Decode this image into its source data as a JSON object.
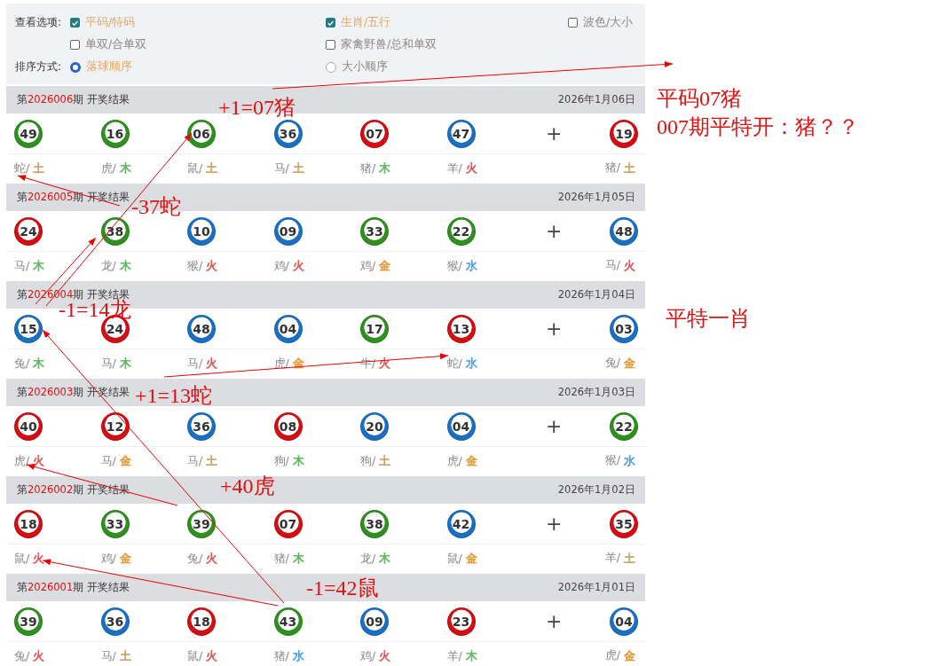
{
  "options": {
    "view_label": "查看选项:",
    "view": [
      {
        "label": "平码/特码",
        "checked": true
      },
      {
        "label": "生肖/五行",
        "checked": true
      },
      {
        "label": "波色/大小",
        "checked": false
      },
      {
        "label": "单双/合单双",
        "checked": false
      },
      {
        "label": "家禽野兽/总和单双",
        "checked": false
      }
    ],
    "sort_label": "排序方式:",
    "sort": [
      {
        "label": "落球顺序",
        "selected": true
      },
      {
        "label": "大小顺序",
        "selected": false
      }
    ]
  },
  "draws": [
    {
      "prefix": "第",
      "period": "2026006",
      "suffix": "期 开奖结果",
      "date": "2026年1月06日",
      "plus": "+",
      "balls": [
        {
          "number": "49",
          "color": "#2f8f1f",
          "zodiac": "蛇/",
          "element": {
            "text": "土",
            "color": "#c9a063"
          }
        },
        {
          "number": "16",
          "color": "#2f8f1f",
          "zodiac": "虎/",
          "element": {
            "text": "木",
            "color": "#5db85c"
          }
        },
        {
          "number": "06",
          "color": "#2f8f1f",
          "zodiac": "鼠/",
          "element": {
            "text": "土",
            "color": "#c9a063"
          }
        },
        {
          "number": "36",
          "color": "#1b6fc2",
          "zodiac": "马/",
          "element": {
            "text": "土",
            "color": "#c9a063"
          }
        },
        {
          "number": "07",
          "color": "#d40d12",
          "zodiac": "猪/",
          "element": {
            "text": "木",
            "color": "#5db85c"
          }
        },
        {
          "number": "47",
          "color": "#1b6fc2",
          "zodiac": "羊/",
          "element": {
            "text": "火",
            "color": "#e05555"
          }
        }
      ],
      "special": {
        "number": "19",
        "color": "#d40d12",
        "zodiac": "猪/",
        "element": {
          "text": "土",
          "color": "#c9a063"
        }
      }
    },
    {
      "prefix": "第",
      "period": "2026005",
      "suffix": "期 开奖结果",
      "date": "2026年1月05日",
      "plus": "+",
      "balls": [
        {
          "number": "24",
          "color": "#d40d12",
          "zodiac": "马/",
          "element": {
            "text": "木",
            "color": "#5db85c"
          }
        },
        {
          "number": "38",
          "color": "#2f8f1f",
          "zodiac": "龙/",
          "element": {
            "text": "木",
            "color": "#5db85c"
          }
        },
        {
          "number": "10",
          "color": "#1b6fc2",
          "zodiac": "猴/",
          "element": {
            "text": "火",
            "color": "#e05555"
          }
        },
        {
          "number": "09",
          "color": "#1b6fc2",
          "zodiac": "鸡/",
          "element": {
            "text": "火",
            "color": "#e05555"
          }
        },
        {
          "number": "33",
          "color": "#2f8f1f",
          "zodiac": "鸡/",
          "element": {
            "text": "金",
            "color": "#e8962e"
          }
        },
        {
          "number": "22",
          "color": "#2f8f1f",
          "zodiac": "猴/",
          "element": {
            "text": "水",
            "color": "#4a9fe0"
          }
        }
      ],
      "special": {
        "number": "48",
        "color": "#1b6fc2",
        "zodiac": "马/",
        "element": {
          "text": "火",
          "color": "#e05555"
        }
      }
    },
    {
      "prefix": "第",
      "period": "2026004",
      "suffix": "期 开奖结果",
      "date": "2026年1月04日",
      "plus": "+",
      "balls": [
        {
          "number": "15",
          "color": "#1b6fc2",
          "zodiac": "兔/",
          "element": {
            "text": "木",
            "color": "#5db85c"
          }
        },
        {
          "number": "24",
          "color": "#d40d12",
          "zodiac": "马/",
          "element": {
            "text": "木",
            "color": "#5db85c"
          }
        },
        {
          "number": "48",
          "color": "#1b6fc2",
          "zodiac": "马/",
          "element": {
            "text": "火",
            "color": "#e05555"
          }
        },
        {
          "number": "04",
          "color": "#1b6fc2",
          "zodiac": "虎/",
          "element": {
            "text": "金",
            "color": "#e8962e"
          }
        },
        {
          "number": "17",
          "color": "#2f8f1f",
          "zodiac": "牛/",
          "element": {
            "text": "火",
            "color": "#e05555"
          }
        },
        {
          "number": "13",
          "color": "#d40d12",
          "zodiac": "蛇/",
          "element": {
            "text": "水",
            "color": "#4a9fe0"
          }
        }
      ],
      "special": {
        "number": "03",
        "color": "#1b6fc2",
        "zodiac": "兔/",
        "element": {
          "text": "金",
          "color": "#e8962e"
        }
      }
    },
    {
      "prefix": "第",
      "period": "2026003",
      "suffix": "期 开奖结果",
      "date": "2026年1月03日",
      "plus": "+",
      "balls": [
        {
          "number": "40",
          "color": "#d40d12",
          "zodiac": "虎/",
          "element": {
            "text": "火",
            "color": "#e05555"
          }
        },
        {
          "number": "12",
          "color": "#d40d12",
          "zodiac": "马/",
          "element": {
            "text": "金",
            "color": "#e8962e"
          }
        },
        {
          "number": "36",
          "color": "#1b6fc2",
          "zodiac": "马/",
          "element": {
            "text": "土",
            "color": "#c9a063"
          }
        },
        {
          "number": "08",
          "color": "#d40d12",
          "zodiac": "狗/",
          "element": {
            "text": "木",
            "color": "#5db85c"
          }
        },
        {
          "number": "20",
          "color": "#1b6fc2",
          "zodiac": "狗/",
          "element": {
            "text": "土",
            "color": "#c9a063"
          }
        },
        {
          "number": "04",
          "color": "#1b6fc2",
          "zodiac": "虎/",
          "element": {
            "text": "金",
            "color": "#e8962e"
          }
        }
      ],
      "special": {
        "number": "22",
        "color": "#2f8f1f",
        "zodiac": "猴/",
        "element": {
          "text": "水",
          "color": "#4a9fe0"
        }
      }
    },
    {
      "prefix": "第",
      "period": "2026002",
      "suffix": "期 开奖结果",
      "date": "2026年1月02日",
      "plus": "+",
      "balls": [
        {
          "number": "18",
          "color": "#d40d12",
          "zodiac": "鼠/",
          "element": {
            "text": "火",
            "color": "#e05555"
          }
        },
        {
          "number": "33",
          "color": "#2f8f1f",
          "zodiac": "鸡/",
          "element": {
            "text": "金",
            "color": "#e8962e"
          }
        },
        {
          "number": "39",
          "color": "#2f8f1f",
          "zodiac": "兔/",
          "element": {
            "text": "火",
            "color": "#e05555"
          }
        },
        {
          "number": "07",
          "color": "#d40d12",
          "zodiac": "猪/",
          "element": {
            "text": "木",
            "color": "#5db85c"
          }
        },
        {
          "number": "38",
          "color": "#2f8f1f",
          "zodiac": "龙/",
          "element": {
            "text": "木",
            "color": "#5db85c"
          }
        },
        {
          "number": "42",
          "color": "#1b6fc2",
          "zodiac": "鼠/",
          "element": {
            "text": "金",
            "color": "#e8962e"
          }
        }
      ],
      "special": {
        "number": "35",
        "color": "#d40d12",
        "zodiac": "羊/",
        "element": {
          "text": "土",
          "color": "#c9a063"
        }
      }
    },
    {
      "prefix": "第",
      "period": "2026001",
      "suffix": "期 开奖结果",
      "date": "2026年1月01日",
      "plus": "+",
      "balls": [
        {
          "number": "39",
          "color": "#2f8f1f",
          "zodiac": "兔/",
          "element": {
            "text": "火",
            "color": "#e05555"
          }
        },
        {
          "number": "36",
          "color": "#1b6fc2",
          "zodiac": "马/",
          "element": {
            "text": "土",
            "color": "#c9a063"
          }
        },
        {
          "number": "18",
          "color": "#d40d12",
          "zodiac": "鼠/",
          "element": {
            "text": "火",
            "color": "#e05555"
          }
        },
        {
          "number": "43",
          "color": "#2f8f1f",
          "zodiac": "猪/",
          "element": {
            "text": "水",
            "color": "#4a9fe0"
          }
        },
        {
          "number": "09",
          "color": "#1b6fc2",
          "zodiac": "鸡/",
          "element": {
            "text": "火",
            "color": "#e05555"
          }
        },
        {
          "number": "23",
          "color": "#d40d12",
          "zodiac": "羊/",
          "element": {
            "text": "木",
            "color": "#5db85c"
          }
        }
      ],
      "special": {
        "number": "04",
        "color": "#1b6fc2",
        "zodiac": "虎/",
        "element": {
          "text": "金",
          "color": "#e8962e"
        }
      }
    }
  ],
  "annotations": [
    {
      "text": "平码07猪"
    },
    {
      "text": "007期平特开：猪？？"
    },
    {
      "text": "+1=07猪"
    },
    {
      "text": "-37蛇"
    },
    {
      "text": "-1=14龙"
    },
    {
      "text": "平特一肖"
    },
    {
      "text": "+1=13蛇"
    },
    {
      "text": "+40虎"
    },
    {
      "text": "-1=42鼠"
    }
  ]
}
